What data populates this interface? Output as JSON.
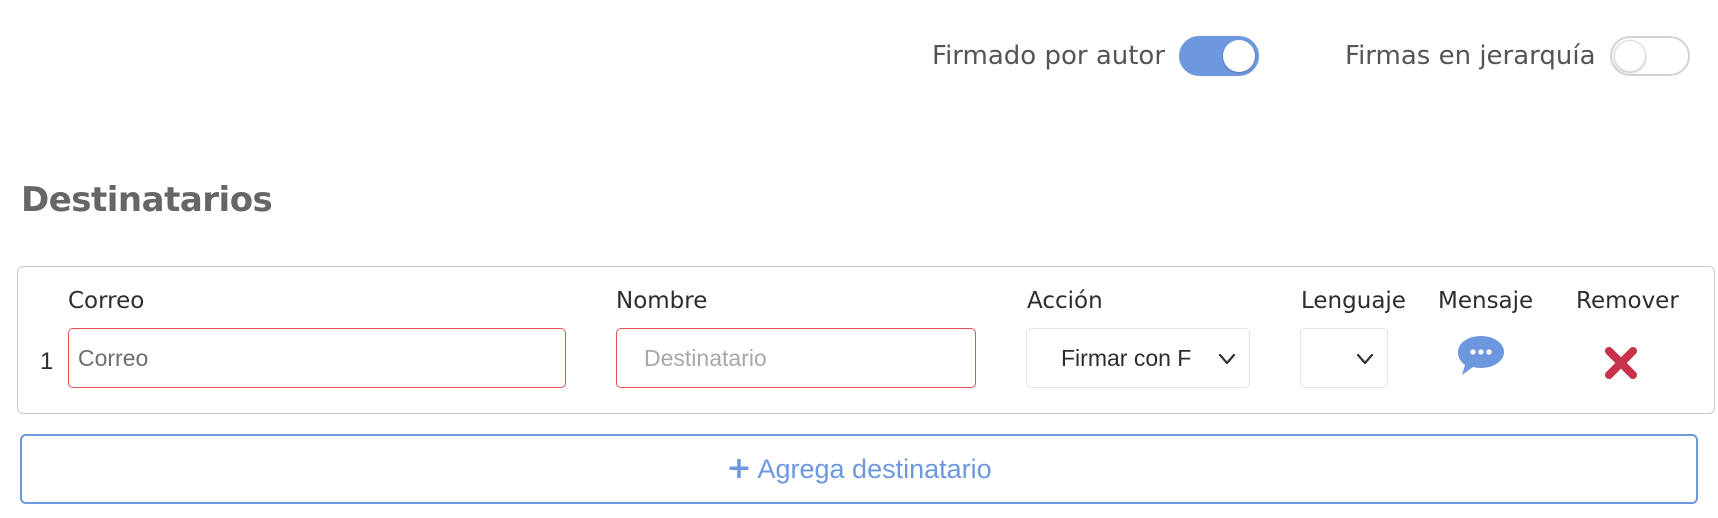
{
  "toggles": [
    {
      "label": "Firmado por autor",
      "state": "on"
    },
    {
      "label": "Firmas en jerarquía",
      "state": "off"
    }
  ],
  "section": {
    "title": "Destinatarios"
  },
  "columns": {
    "email": "Correo",
    "name": "Nombre",
    "action": "Acción",
    "language": "Lenguaje",
    "message": "Mensaje",
    "remove": "Remover"
  },
  "rows": [
    {
      "index": "1",
      "email_placeholder": "Correo",
      "name_placeholder": "Destinatario",
      "action_value": "Firmar con F",
      "language_value": ""
    }
  ],
  "icons": {
    "message": "chat-bubble-icon",
    "remove": "close-x-icon",
    "select": "chevron-down-icon",
    "add": "plus-icon"
  },
  "add_button": {
    "plus": "+",
    "label": "Agrega destinatario"
  },
  "colors": {
    "accent": "#6d98e0",
    "error_border": "#e05353",
    "remove_icon": "#c8334b"
  }
}
